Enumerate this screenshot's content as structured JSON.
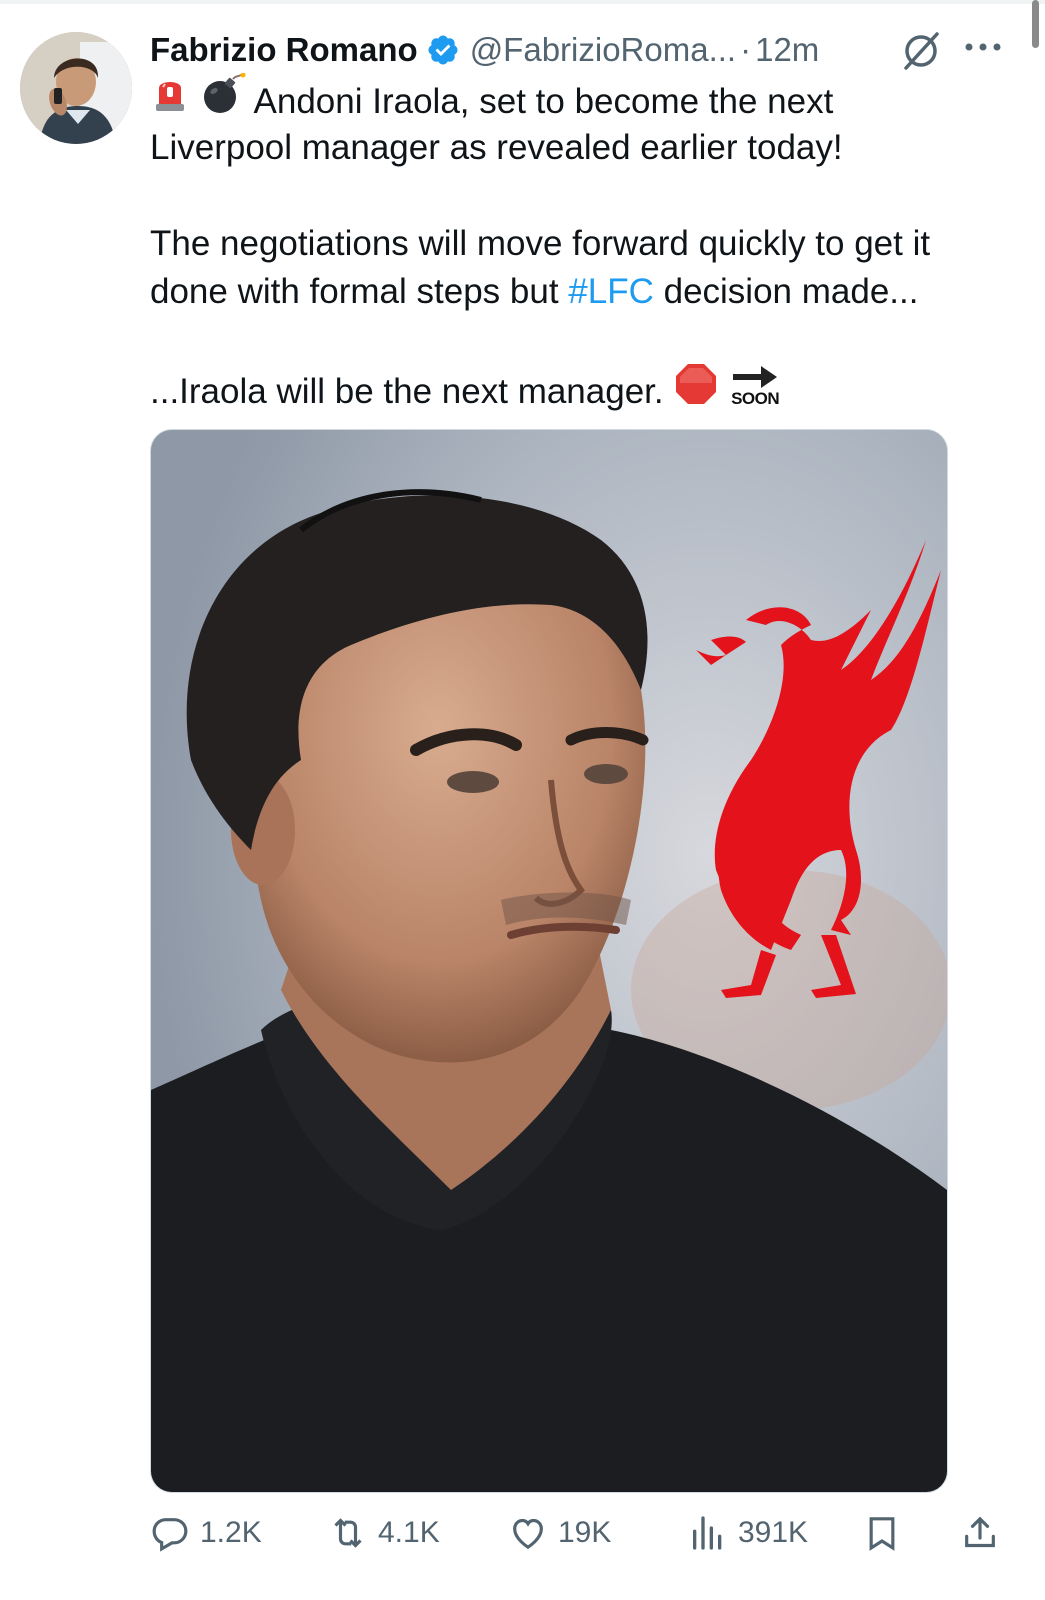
{
  "tweet": {
    "author_name": "Fabrizio Romano",
    "handle": "@FabrizioRoma...",
    "separator": "·",
    "time": "12m",
    "line1": "Andoni Iraola, set to become the next",
    "line2": "Liverpool manager as revealed earlier today!",
    "line3": "The negotiations will move forward quickly to get it",
    "line4_a": "done with formal steps but ",
    "hashtag": "#LFC",
    "line4_b": " decision made...",
    "line5": "...Iraola will be the next manager.",
    "soon_label": "SOON"
  },
  "actions": {
    "replies": "1.2K",
    "reposts": "4.1K",
    "likes": "19K",
    "views": "391K"
  },
  "colors": {
    "link_blue": "#1d9bf0",
    "muted_gray": "#536471",
    "liverbird_red": "#e3121b"
  },
  "icons": [
    "verified-badge-icon",
    "grok-icon",
    "more-icon",
    "siren-icon",
    "bomb-icon",
    "stop-sign-icon",
    "soon-arrow-icon",
    "reply-icon",
    "repost-icon",
    "like-icon",
    "views-icon",
    "bookmark-icon",
    "share-icon"
  ]
}
